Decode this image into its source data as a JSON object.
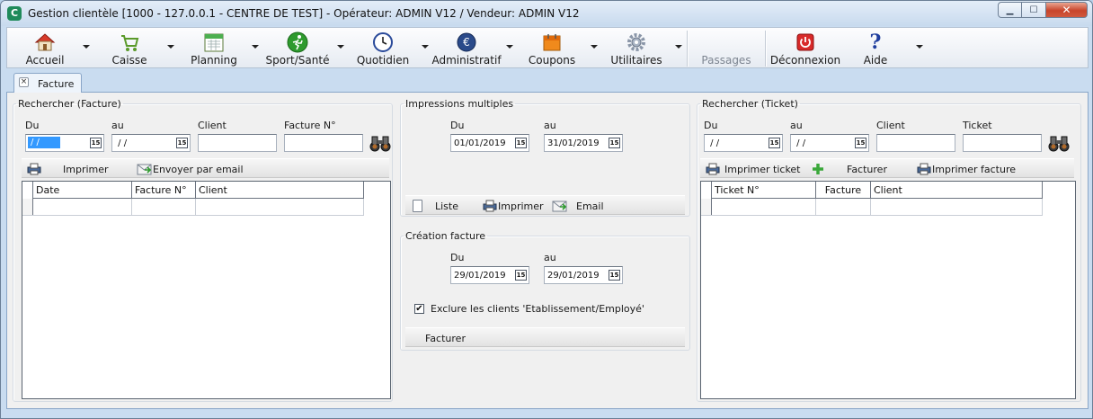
{
  "window": {
    "title": "Gestion clientèle [1000 - 127.0.0.1 - CENTRE DE TEST] - Opérateur: ADMIN V12 / Vendeur: ADMIN V12",
    "app_icon_letter": "C",
    "minimize_symbol": "▁",
    "maximize_symbol": "☐",
    "close_symbol": "✕"
  },
  "toolbar": {
    "items": [
      {
        "label": "Accueil",
        "icon": "house-icon"
      },
      {
        "label": "Caisse",
        "icon": "cart-icon"
      },
      {
        "label": "Planning",
        "icon": "calendar-icon"
      },
      {
        "label": "Sport/Santé",
        "icon": "runner-icon"
      },
      {
        "label": "Quotidien",
        "icon": "clock-icon"
      },
      {
        "label": "Administratif",
        "icon": "euro-icon"
      },
      {
        "label": "Coupons",
        "icon": "coupon-icon"
      },
      {
        "label": "Utilitaires",
        "icon": "gear-icon"
      },
      {
        "label": "Passages",
        "icon": "none"
      },
      {
        "label": "Déconnexion",
        "icon": "power-icon"
      },
      {
        "label": "Aide",
        "icon": "help-icon"
      }
    ],
    "help_symbol": "?"
  },
  "tabs": [
    {
      "label": "Facture",
      "close_symbol": "×"
    }
  ],
  "search_facture": {
    "legend": "Rechercher (Facture)",
    "du_label": "Du",
    "au_label": "au",
    "client_label": "Client",
    "facture_label": "Facture N°",
    "du_value": " / /",
    "au_value": " / /",
    "client_value": "",
    "facture_value": "",
    "cal_glyph": "15",
    "print_label": "Imprimer",
    "email_label": "Envoyer par email",
    "columns": [
      "Date",
      "Facture N°",
      "Client"
    ]
  },
  "impressions": {
    "legend": "Impressions multiples",
    "du_label": "Du",
    "au_label": "au",
    "du_value": "01/01/2019",
    "au_value": "31/01/2019",
    "liste_label": "Liste",
    "print_label": "Imprimer",
    "email_label": "Email"
  },
  "creation": {
    "legend": "Création facture",
    "du_label": "Du",
    "au_label": "au",
    "du_value": "29/01/2019",
    "au_value": "29/01/2019",
    "exclude_label": "Exclure les clients 'Etablissement/Employé'",
    "exclude_checked_symbol": "✔",
    "facturer_label": "Facturer"
  },
  "search_ticket": {
    "legend": "Rechercher (Ticket)",
    "du_label": "Du",
    "au_label": "au",
    "client_label": "Client",
    "ticket_label": "Ticket",
    "du_value": " / /",
    "au_value": " / /",
    "client_value": "",
    "ticket_value": "",
    "print_ticket_label": "Imprimer ticket",
    "facturer_label": "Facturer",
    "print_facture_label": "Imprimer facture",
    "columns": [
      "Ticket N°",
      "Facture",
      "Client"
    ]
  }
}
